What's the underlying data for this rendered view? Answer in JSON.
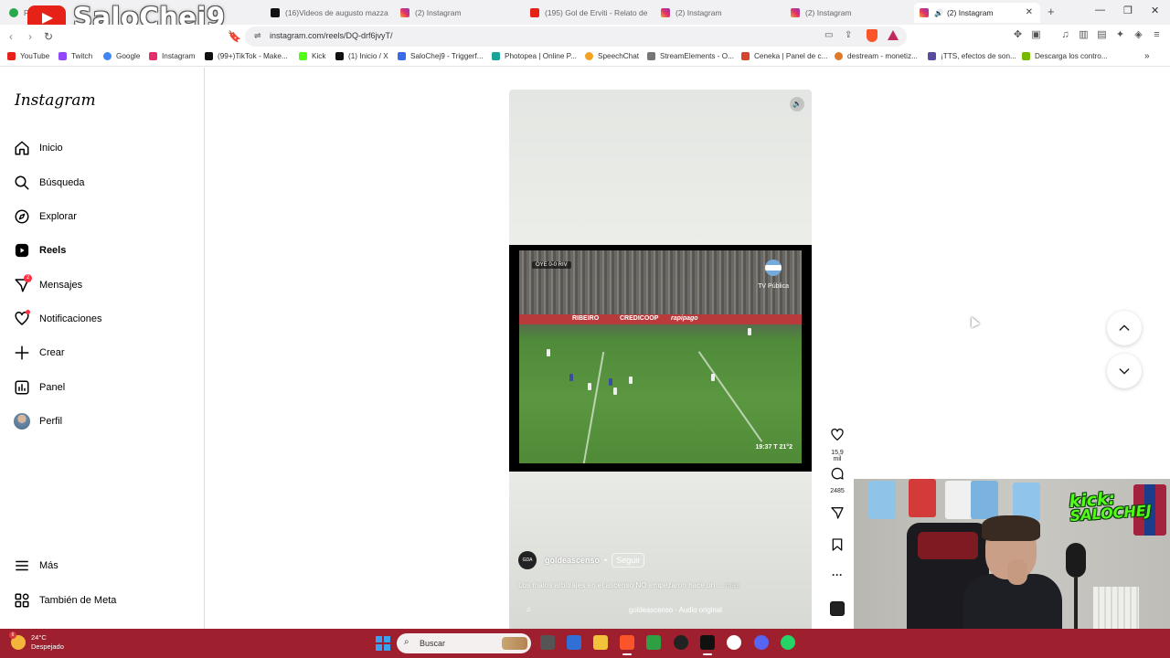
{
  "browser": {
    "tabs": [
      {
        "label": "Fe",
        "icon": "green-icon"
      },
      {
        "label": "(16)Videos de augusto mazza",
        "icon": "tiktok-icon"
      },
      {
        "label": "(2) Instagram",
        "icon": "instagram-icon"
      },
      {
        "label": "(195) Gol de Erviti - Relato de",
        "icon": "youtube-icon"
      },
      {
        "label": "(2) Instagram",
        "icon": "instagram-icon"
      },
      {
        "label": "(2) Instagram",
        "icon": "instagram-icon"
      },
      {
        "label": "(2) Instagram",
        "icon": "instagram-icon",
        "active": true
      }
    ],
    "new_tab": "+",
    "url": "instagram.com/reels/DQ-drf6jvyT/",
    "bookmarks": [
      {
        "label": "YouTube",
        "color": "#e62117"
      },
      {
        "label": "Twitch",
        "color": "#9146ff"
      },
      {
        "label": "Google",
        "color": "#4285f4"
      },
      {
        "label": "Instagram",
        "color": "#e1306c"
      },
      {
        "label": "(99+)TikTok - Make...",
        "color": "#111111"
      },
      {
        "label": "Kick",
        "color": "#53fc18"
      },
      {
        "label": "(1) Inicio / X",
        "color": "#111111"
      },
      {
        "label": "SaloChej9 - Triggerf...",
        "color": "#3a6ae8"
      },
      {
        "label": "Photopea | Online P...",
        "color": "#18a497"
      },
      {
        "label": "SpeechChat",
        "color": "#f4a225"
      },
      {
        "label": "StreamElements - O...",
        "color": "#777777"
      },
      {
        "label": "Ceneka | Panel de c...",
        "color": "#d6452b"
      },
      {
        "label": "destream - monetiz...",
        "color": "#e07a2b"
      },
      {
        "label": "¡TTS, efectos de son...",
        "color": "#5b4ba0"
      },
      {
        "label": "Descarga los contro...",
        "color": "#76b900"
      }
    ],
    "more_bookmarks": "»"
  },
  "stream_overlay": {
    "channel_name": "SaloChej9"
  },
  "instagram": {
    "logo": "Instagram",
    "nav": [
      {
        "label": "Inicio",
        "icon": "home-icon"
      },
      {
        "label": "Búsqueda",
        "icon": "search-icon"
      },
      {
        "label": "Explorar",
        "icon": "compass-icon"
      },
      {
        "label": "Reels",
        "icon": "reels-icon",
        "active": true
      },
      {
        "label": "Mensajes",
        "icon": "messenger-icon",
        "badge": "2"
      },
      {
        "label": "Notificaciones",
        "icon": "heart-icon",
        "dot": true
      },
      {
        "label": "Crear",
        "icon": "plus-icon"
      },
      {
        "label": "Panel",
        "icon": "chart-icon"
      },
      {
        "label": "Perfil",
        "icon": "avatar-icon"
      }
    ],
    "bottom_nav": [
      {
        "label": "Más",
        "icon": "menu-icon"
      },
      {
        "label": "También de Meta",
        "icon": "meta-icon"
      }
    ],
    "reel": {
      "video": {
        "scoreboard": "OYE 0-0 RIV",
        "broadcaster": "TV Pública",
        "clock": "19:37  T 21°2",
        "ad_texts": [
          "RIBEIRO",
          "CREDICOOP",
          "rapipago"
        ]
      },
      "author": {
        "avatar_text": "GDA",
        "username": "goldeascenso",
        "separator": "•",
        "follow_label": "Seguir"
      },
      "caption": "Los malos arbitrajes en el ascenso NO empezaron hace un ...",
      "caption_more": "más",
      "audio": "goldeascenso · Audio original",
      "actions": {
        "likes": "15,9 mil",
        "comments": "2485"
      }
    }
  },
  "webcam": {
    "kick_label": "kick:",
    "kick_handle": "SALOCHEJ"
  },
  "taskbar": {
    "weather_temp": "24°C",
    "weather_desc": "Despejado",
    "weather_badge": "6",
    "search_placeholder": "Buscar"
  }
}
